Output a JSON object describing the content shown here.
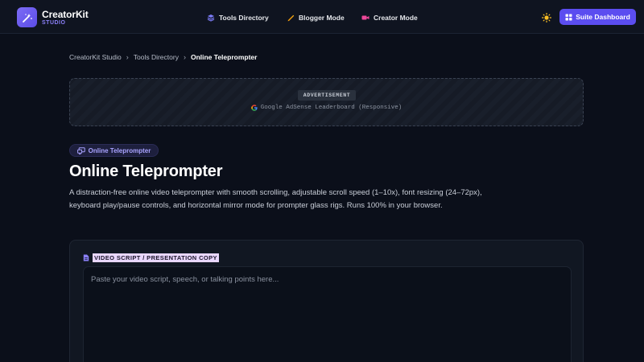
{
  "brand": {
    "name": "CreatorKit",
    "sub": "STUDIO"
  },
  "nav": [
    {
      "label": "Tools Directory",
      "icon": "layers-icon"
    },
    {
      "label": "Blogger Mode",
      "icon": "pencil-icon"
    },
    {
      "label": "Creator Mode",
      "icon": "video-icon"
    }
  ],
  "header": {
    "cta_label": "Suite Dashboard",
    "theme_icon": "sun-icon"
  },
  "breadcrumb": {
    "items": [
      "CreatorKit Studio",
      "Tools Directory"
    ],
    "current": "Online Teleprompter"
  },
  "ad": {
    "tag": "ADVERTISEMENT",
    "text": "Google AdSense Leaderboard (Responsive)"
  },
  "tool": {
    "pill": "Online Teleprompter",
    "title": "Online Teleprompter",
    "description": "A distraction-free online video teleprompter with smooth scrolling, adjustable scroll speed (1–10x), font resizing (24–72px), keyboard play/pause controls, and horizontal mirror mode for prompter glass rigs. Runs 100% in your browser."
  },
  "script": {
    "label": "VIDEO SCRIPT / PRESENTATION COPY",
    "placeholder": "Paste your video script, speech, or talking points here..."
  },
  "colors": {
    "accent": "#5b4df0",
    "background": "#0b0f1a",
    "highlight": "#e9d7ff"
  }
}
